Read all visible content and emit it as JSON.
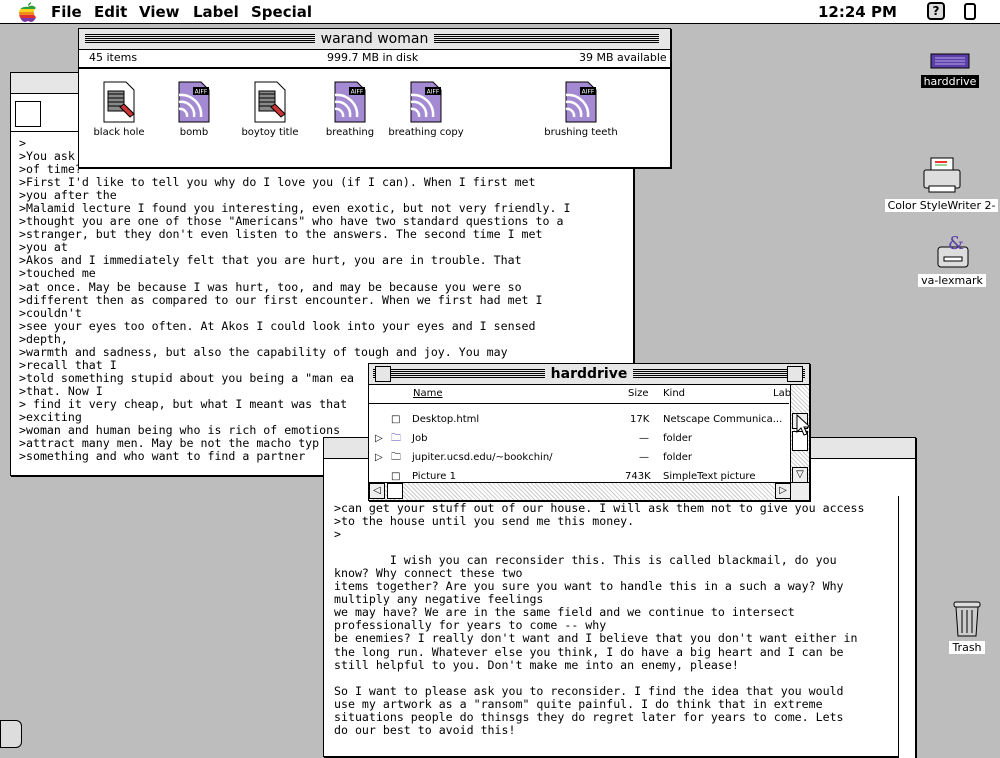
{
  "menubar": {
    "menus": [
      "File",
      "Edit",
      "View",
      "Label",
      "Special"
    ],
    "clock": "12:24 PM",
    "help_label": "?"
  },
  "folder_window": {
    "title": "warand woman",
    "item_count": "45 items",
    "disk_usage": "999.7 MB in disk",
    "available": "39 MB available",
    "files": [
      {
        "name": "black hole",
        "icon": "movie-file-icon"
      },
      {
        "name": "bomb",
        "icon": "aiff-sound-file-icon"
      },
      {
        "name": "boytoy title",
        "icon": "movie-file-icon"
      },
      {
        "name": "breathing",
        "icon": "aiff-sound-file-icon"
      },
      {
        "name": "breathing copy",
        "icon": "aiff-sound-file-icon"
      },
      {
        "name": "brushing teeth",
        "icon": "aiff-sound-file-icon"
      }
    ]
  },
  "letter_window_back": {
    "text": ">\n>You ask\n>of time?\n>First I'd like to tell you why do I love you (if I can). When I first met\n>you after the\n>Malamid lecture I found you interesting, even exotic, but not very friendly. I\n>thought you are one of those \"Americans\" who have two standard questions to a\n>stranger, but they don't even listen to the answers. The second time I met\n>you at\n>Akos and I immediately felt that you are hurt, you are in trouble. That\n>touched me\n>at once. May be because I was hurt, too, and may be because you were so\n>different then as compared to our first encounter. When we first had met I\n>couldn't\n>see your eyes too often. At Akos I could look into your eyes and I sensed\n>depth,\n>warmth and sadness, but also the capability of tough and joy. You may\n>recall that I\n>told something stupid about you being a \"man ea\n>that. Now I\n> find it very cheap, but what I meant was that\n>exciting\n>woman and human being who is rich of emotions\n>attract many men. May be not the macho typ\n>something and who want to find a partner"
  },
  "harddrive_window": {
    "title": "harddrive",
    "columns": {
      "name": "Name",
      "size": "Size",
      "kind": "Kind",
      "label": "Lab"
    },
    "rows": [
      {
        "name": "Desktop.html",
        "size": "17K",
        "kind": "Netscape Communica...",
        "type": "document",
        "expandable": false
      },
      {
        "name": "Job",
        "size": "—",
        "kind": "folder",
        "type": "folder",
        "expandable": true
      },
      {
        "name": "jupiter.ucsd.edu/~bookchin/",
        "size": "—",
        "kind": "folder",
        "type": "folder",
        "expandable": true
      },
      {
        "name": "Picture 1",
        "size": "743K",
        "kind": "SimpleText picture",
        "type": "document",
        "expandable": false
      }
    ]
  },
  "letter_window_front": {
    "text": ">can get your stuff out of our house. I will ask them not to give you access\n>to the house until you send me this money.\n>\n\n        I wish you can reconsider this. This is called blackmail, do you\nknow? Why connect these two\nitems together? Are you sure you want to handle this in a such a way? Why\nmultiply any negative feelings\nwe may have? We are in the same field and we continue to intersect\nprofessionally for years to come -- why\nbe enemies? I really don't want and I believe that you don't want either in\nthe long run. Whatever else you think, I do have a big heart and I can be\nstill helpful to you. Don't make me into an enemy, please!\n\nSo I want to please ask you to reconsider. I find the idea that you would\nuse my artwork as a \"ransom\" quite painful. I do think that in extreme\nsituations people do thinsgs they do regret later for years to come. Lets\ndo our best to avoid this!"
  },
  "desktop_icons": [
    {
      "name": "harddrive",
      "icon": "harddrive-icon",
      "selected": true
    },
    {
      "name": "Color StyleWriter 2-",
      "icon": "printer-icon",
      "selected": false
    },
    {
      "name": "va-lexmark",
      "icon": "printer-driver-icon",
      "selected": false
    },
    {
      "name": "Trash",
      "icon": "trash-icon",
      "selected": false
    }
  ]
}
